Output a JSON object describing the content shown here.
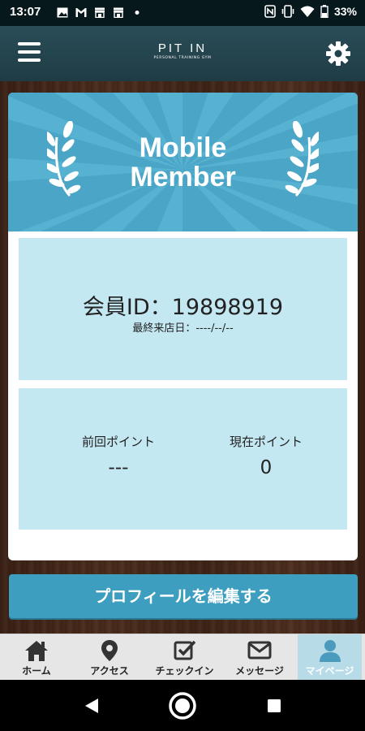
{
  "status_bar": {
    "time": "13:07",
    "battery": "33%",
    "left_icons": [
      "image-icon",
      "gmail-icon",
      "store-icon",
      "store-icon",
      "dot-icon"
    ],
    "right_icons": [
      "nfc-icon",
      "vibrate-icon",
      "wifi-icon",
      "battery-icon"
    ]
  },
  "header": {
    "logo_main": "PIT IN",
    "logo_sub": "PERSONAL TRAINING GYM",
    "menu_icon": "hamburger-menu-icon",
    "settings_icon": "gear-icon"
  },
  "banner": {
    "line1": "Mobile",
    "line2": "Member",
    "color": "#4aa5c6"
  },
  "member": {
    "id_text": "会員ID：19898919",
    "last_visit": "最終来店日：----/--/--"
  },
  "points": {
    "previous_label": "前回ポイント",
    "previous_value": "---",
    "current_label": "現在ポイント",
    "current_value": "0"
  },
  "edit_button": {
    "label": "プロフィールを編集する",
    "color": "#3d9ec0"
  },
  "bottom_nav": {
    "items": [
      {
        "label": "ホーム",
        "icon": "home-icon"
      },
      {
        "label": "アクセス",
        "icon": "map-pin-icon"
      },
      {
        "label": "チェックイン",
        "icon": "checkbox-icon"
      },
      {
        "label": "メッセージ",
        "icon": "envelope-icon"
      },
      {
        "label": "マイページ",
        "icon": "user-icon"
      }
    ],
    "active_index": 4
  },
  "colors": {
    "header": "#1f3c45",
    "panel": "#c4e8f1",
    "accent": "#3d9ec0"
  }
}
